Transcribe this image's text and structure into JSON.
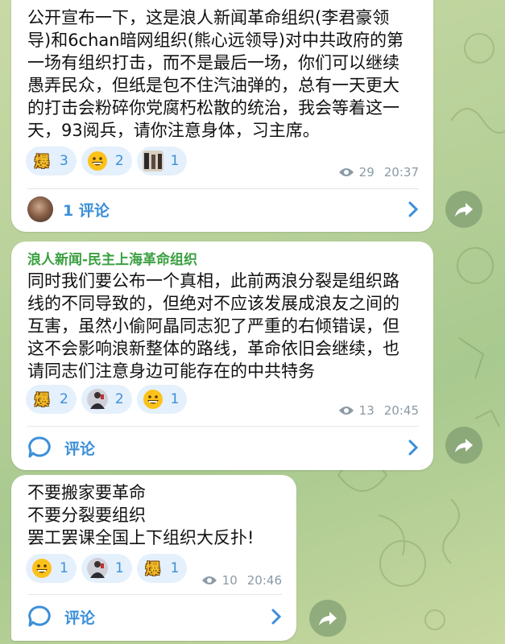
{
  "messages": [
    {
      "text": "公开宣布一下，这是浪人新闻革命组织(李君豪领\n导)和6chan暗网组织(熊心远领导)对中共政府的第\n一场有组织打击，而不是最后一场，你们可以继续\n愚弄民众，但纸是包不住汽油弹的，总有一天更大\n的打击会粉碎你党腐朽松散的统治，我会等着这一\n天，93阅兵，请你注意身体，习主席。",
      "reactions": [
        {
          "icon": "bao-sticker-icon",
          "label": "爆",
          "count": "3"
        },
        {
          "icon": "grinning-face-icon",
          "count": "2"
        },
        {
          "icon": "photo-reaction-icon",
          "count": "1"
        }
      ],
      "views": "29",
      "time": "20:37",
      "comment_label": "1 评论"
    },
    {
      "sender": "浪人新闻-民主上海革命组织",
      "text": "同时我们要公布一个真相，此前两浪分裂是组织路\n线的不同导致的，但绝对不应该发展成浪友之间的\n互害，虽然小偷阿晶同志犯了严重的右倾错误，但\n这不会影响浪新整体的路线，革命依旧会继续，也\n请同志们注意身边可能存在的中共特务",
      "reactions": [
        {
          "icon": "bao-sticker-icon",
          "label": "爆",
          "count": "2"
        },
        {
          "icon": "photo-reaction-icon",
          "count": "2"
        },
        {
          "icon": "grinning-face-icon",
          "count": "1"
        }
      ],
      "views": "13",
      "time": "20:45",
      "comment_label": "评论"
    },
    {
      "text": "不要搬家要革命\n不要分裂要组织\n罢工罢课全国上下组织大反扑!",
      "reactions": [
        {
          "icon": "grinning-face-icon",
          "count": "1"
        },
        {
          "icon": "photo-reaction-icon",
          "count": "1"
        },
        {
          "icon": "bao-sticker-icon",
          "label": "爆",
          "count": "1"
        }
      ],
      "views": "10",
      "time": "20:46",
      "comment_label": "评论"
    }
  ],
  "colors": {
    "accent": "#3b8fd8",
    "sender": "#3aa040",
    "reaction_bg": "#e4f0fb"
  }
}
